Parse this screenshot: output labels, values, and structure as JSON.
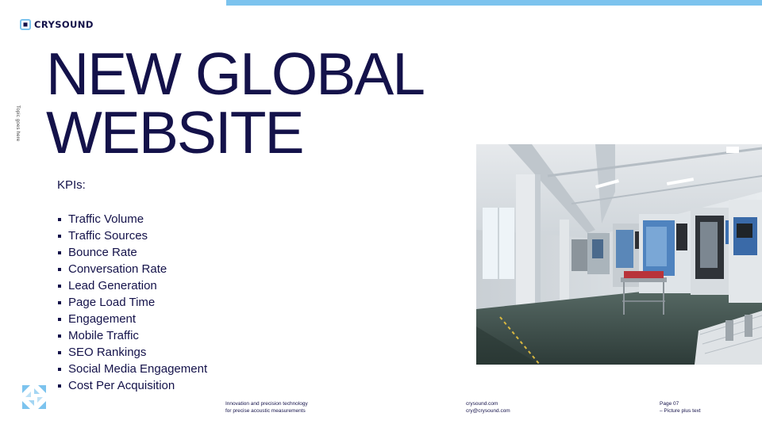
{
  "brand": {
    "name": "CRYSOUND",
    "accent": "#7cc3ee",
    "ink": "#14124a"
  },
  "side_topic": "Topic goes here",
  "title": {
    "line1": "NEW GLOBAL",
    "line2": "WEBSITE"
  },
  "kpis": {
    "heading": "KPIs:",
    "items": [
      "Traffic Volume",
      "Traffic Sources",
      "Bounce Rate",
      "Conversation Rate",
      "Lead Generation",
      "Page Load Time",
      "Engagement",
      "Mobile Traffic",
      "SEO Rankings",
      "Social Media Engagement",
      "Cost Per Acquisition"
    ]
  },
  "footer": {
    "tagline_1": "Innovation and precision technology",
    "tagline_2": "for precise acoustic measurements",
    "website": "crysound.com",
    "email": "cry@crysound.com",
    "page": "Page 07",
    "layout_name": "– Picture plus text"
  }
}
